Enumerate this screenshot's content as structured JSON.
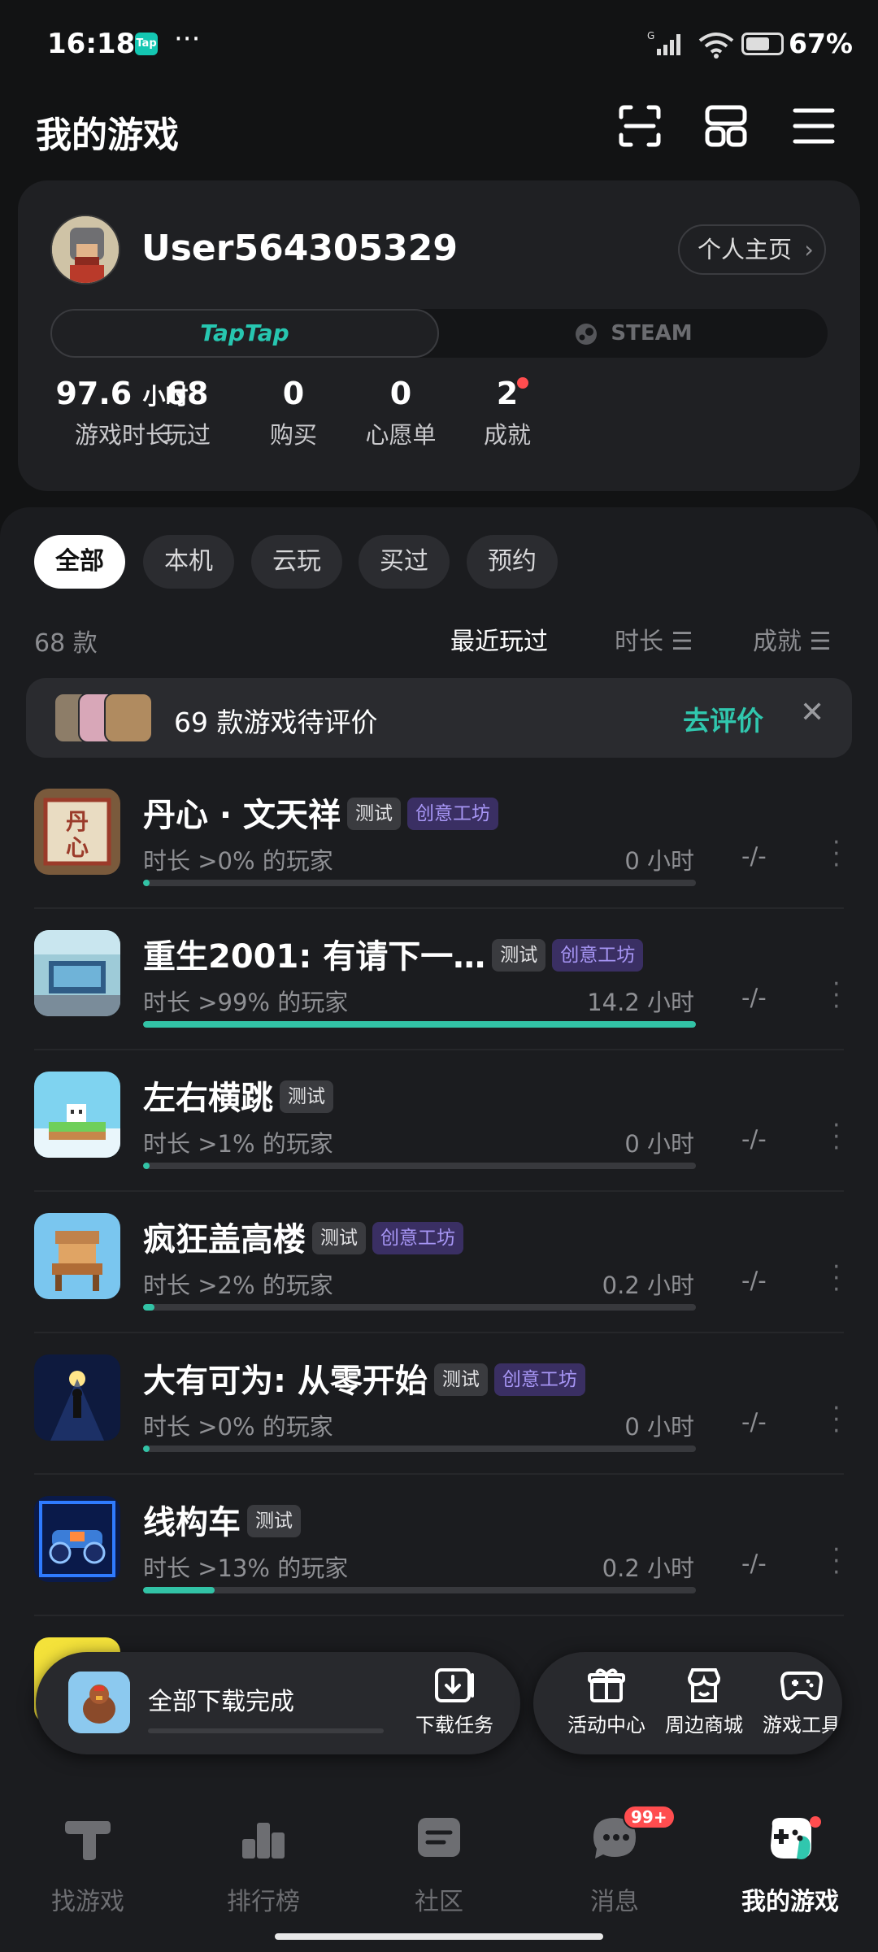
{
  "status_bar": {
    "time": "16:18",
    "app_badge": "Tap",
    "more": "···",
    "network": "G",
    "battery": "67%"
  },
  "header": {
    "title": "我的游戏"
  },
  "profile": {
    "username": "User564305329",
    "homepage_label": "个人主页",
    "platforms": [
      "TapTap",
      "STEAM"
    ],
    "stats": [
      {
        "value": "97.6",
        "unit": "小时",
        "label": "游戏时长"
      },
      {
        "value": "68",
        "label": "玩过"
      },
      {
        "value": "0",
        "label": "购买"
      },
      {
        "value": "0",
        "label": "心愿单"
      },
      {
        "value": "2",
        "label": "成就"
      }
    ]
  },
  "filters": [
    "全部",
    "本机",
    "云玩",
    "买过",
    "预约"
  ],
  "list": {
    "count": "68 款",
    "sorts": [
      "最近玩过",
      "时长",
      "成就"
    ],
    "review_banner": {
      "text": "69 款游戏待评价",
      "action": "去评价",
      "close": "✕"
    },
    "tags": {
      "test": "测试",
      "workshop": "创意工坊"
    },
    "games": [
      {
        "name": "丹心 · 文天祥",
        "pct_text": "时长 >0% 的玩家",
        "hours": "0 小时",
        "achv": "-/-",
        "bar": 0.0
      },
      {
        "name": "重生2001: 有请下一…",
        "pct_text": "时长 >99% 的玩家",
        "hours": "14.2 小时",
        "achv": "-/-",
        "bar": 1.0
      },
      {
        "name": "左右横跳",
        "pct_text": "时长 >1% 的玩家",
        "hours": "0 小时",
        "achv": "-/-",
        "bar": 0.01
      },
      {
        "name": "疯狂盖高楼",
        "pct_text": "时长 >2% 的玩家",
        "hours": "0.2 小时",
        "achv": "-/-",
        "bar": 0.02
      },
      {
        "name": "大有可为: 从零开始",
        "pct_text": "时长 >0% 的玩家",
        "hours": "0 小时",
        "achv": "-/-",
        "bar": 0.0
      },
      {
        "name": "线构车",
        "pct_text": "时长 >13% 的玩家",
        "hours": "0.2 小时",
        "achv": "-/-",
        "bar": 0.13
      }
    ]
  },
  "download_bar": {
    "label": "全部下载完成",
    "task_label": "下载任务"
  },
  "toolbar": [
    "活动中心",
    "周边商城",
    "游戏工具"
  ],
  "nav": [
    {
      "label": "找游戏"
    },
    {
      "label": "排行榜"
    },
    {
      "label": "社区"
    },
    {
      "label": "消息",
      "badge": "99+"
    },
    {
      "label": "我的游戏"
    }
  ],
  "colors": {
    "accent": "#30c7ae",
    "workshop": "#a796f5",
    "badge": "#ff4d4f"
  }
}
